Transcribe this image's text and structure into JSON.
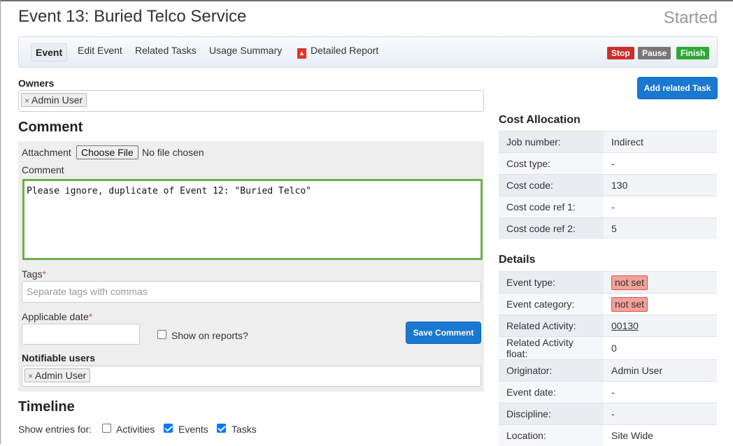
{
  "page": {
    "title": "Event 13: Buried Telco Service",
    "status": "Started"
  },
  "nav": {
    "tabs": [
      "Event",
      "Edit Event",
      "Related Tasks",
      "Usage Summary",
      "Detailed Report"
    ],
    "pdf_icon": "pdf-icon",
    "stop": "Stop",
    "pause": "Pause",
    "finish": "Finish"
  },
  "colors": {
    "stop": "#c9302c",
    "pause": "#777777",
    "finish": "#2ea836",
    "primary": "#1a78d0",
    "focus_border": "#70ad47"
  },
  "owners": {
    "label": "Owners",
    "tokens": [
      "Admin User"
    ]
  },
  "comment": {
    "heading": "Comment",
    "attachment_label": "Attachment",
    "file_button": "Choose File",
    "file_status": "No file chosen",
    "comment_label": "Comment",
    "comment_value": "Please ignore, duplicate of Event 12: \"Buried Telco\"",
    "tags_label": "Tags",
    "required": "*",
    "tags_placeholder": "Separate tags with commas",
    "date_label": "Applicable date",
    "show_reports": "Show on reports?",
    "save_button": "Save Comment",
    "notifiable_label": "Notifiable users",
    "notifiable_tokens": [
      "Admin User"
    ],
    "remove_glyph": "×"
  },
  "timeline": {
    "heading": "Timeline",
    "show_label": "Show entries for:",
    "filters": [
      {
        "label": "Activities",
        "checked": false
      },
      {
        "label": "Events",
        "checked": true
      },
      {
        "label": "Tasks",
        "checked": true
      }
    ]
  },
  "add_task_button": "Add related Task",
  "cost": {
    "heading": "Cost Allocation",
    "rows": [
      {
        "k": "Job number:",
        "v": "Indirect"
      },
      {
        "k": "Cost type:",
        "v": "-"
      },
      {
        "k": "Cost code:",
        "v": "130"
      },
      {
        "k": "Cost code ref 1:",
        "v": "-"
      },
      {
        "k": "Cost code ref 2:",
        "v": "5"
      }
    ]
  },
  "details": {
    "heading": "Details",
    "rows": [
      {
        "k": "Event type:",
        "v": "not set"
      },
      {
        "k": "Event category:",
        "v": "not set"
      },
      {
        "k": "Related Activity:",
        "v": "00130"
      },
      {
        "k": "Related Activity float:",
        "v": "0"
      },
      {
        "k": "Originator:",
        "v": "Admin User"
      },
      {
        "k": "Event date:",
        "v": "-"
      },
      {
        "k": "Discipline:",
        "v": "-"
      },
      {
        "k": "Location:",
        "v": "Site Wide"
      }
    ]
  }
}
